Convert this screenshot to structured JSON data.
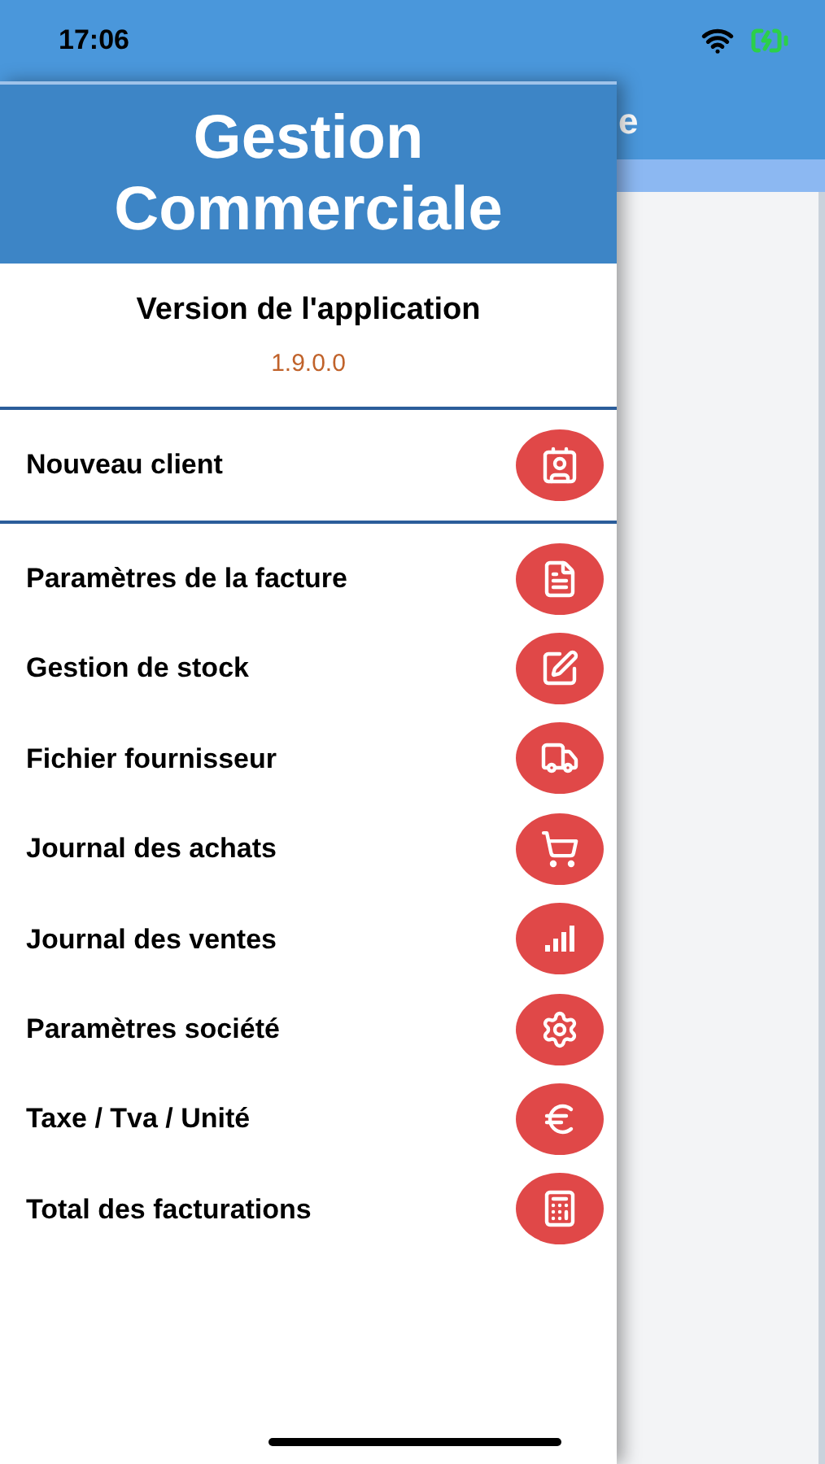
{
  "status_bar": {
    "time": "17:06"
  },
  "background_screen": {
    "title_fragment": "e"
  },
  "drawer": {
    "title": "Gestion Commerciale",
    "version_label": "Version de l'application",
    "version": "1.9.0.0",
    "featured_item": {
      "label": "Nouveau client"
    },
    "items": [
      {
        "label": "Paramètres de la facture"
      },
      {
        "label": "Gestion de stock"
      },
      {
        "label": "Fichier fournisseur"
      },
      {
        "label": "Journal des achats"
      },
      {
        "label": "Journal des ventes"
      },
      {
        "label": "Paramètres société"
      },
      {
        "label": "Taxe / Tva / Unité"
      },
      {
        "label": "Total des facturations"
      }
    ]
  }
}
